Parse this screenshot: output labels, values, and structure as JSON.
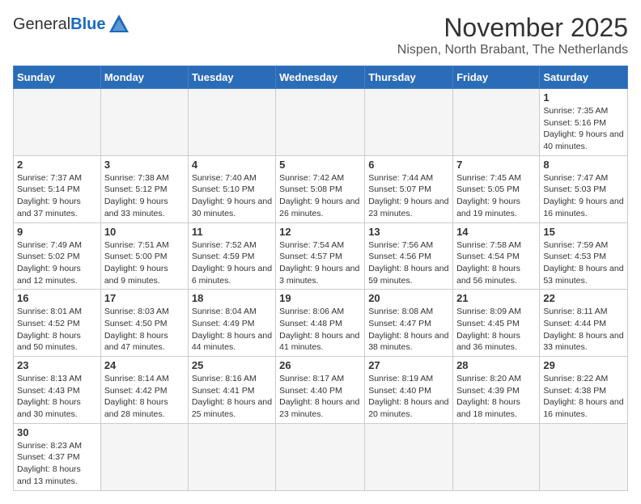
{
  "header": {
    "logo_general": "General",
    "logo_blue": "Blue",
    "month_title": "November 2025",
    "location": "Nispen, North Brabant, The Netherlands"
  },
  "weekdays": [
    "Sunday",
    "Monday",
    "Tuesday",
    "Wednesday",
    "Thursday",
    "Friday",
    "Saturday"
  ],
  "days": [
    {
      "date": "",
      "info": ""
    },
    {
      "date": "",
      "info": ""
    },
    {
      "date": "",
      "info": ""
    },
    {
      "date": "",
      "info": ""
    },
    {
      "date": "",
      "info": ""
    },
    {
      "date": "",
      "info": ""
    },
    {
      "date": "1",
      "info": "Sunrise: 7:35 AM\nSunset: 5:16 PM\nDaylight: 9 hours and 40 minutes."
    },
    {
      "date": "2",
      "info": "Sunrise: 7:37 AM\nSunset: 5:14 PM\nDaylight: 9 hours and 37 minutes."
    },
    {
      "date": "3",
      "info": "Sunrise: 7:38 AM\nSunset: 5:12 PM\nDaylight: 9 hours and 33 minutes."
    },
    {
      "date": "4",
      "info": "Sunrise: 7:40 AM\nSunset: 5:10 PM\nDaylight: 9 hours and 30 minutes."
    },
    {
      "date": "5",
      "info": "Sunrise: 7:42 AM\nSunset: 5:08 PM\nDaylight: 9 hours and 26 minutes."
    },
    {
      "date": "6",
      "info": "Sunrise: 7:44 AM\nSunset: 5:07 PM\nDaylight: 9 hours and 23 minutes."
    },
    {
      "date": "7",
      "info": "Sunrise: 7:45 AM\nSunset: 5:05 PM\nDaylight: 9 hours and 19 minutes."
    },
    {
      "date": "8",
      "info": "Sunrise: 7:47 AM\nSunset: 5:03 PM\nDaylight: 9 hours and 16 minutes."
    },
    {
      "date": "9",
      "info": "Sunrise: 7:49 AM\nSunset: 5:02 PM\nDaylight: 9 hours and 12 minutes."
    },
    {
      "date": "10",
      "info": "Sunrise: 7:51 AM\nSunset: 5:00 PM\nDaylight: 9 hours and 9 minutes."
    },
    {
      "date": "11",
      "info": "Sunrise: 7:52 AM\nSunset: 4:59 PM\nDaylight: 9 hours and 6 minutes."
    },
    {
      "date": "12",
      "info": "Sunrise: 7:54 AM\nSunset: 4:57 PM\nDaylight: 9 hours and 3 minutes."
    },
    {
      "date": "13",
      "info": "Sunrise: 7:56 AM\nSunset: 4:56 PM\nDaylight: 8 hours and 59 minutes."
    },
    {
      "date": "14",
      "info": "Sunrise: 7:58 AM\nSunset: 4:54 PM\nDaylight: 8 hours and 56 minutes."
    },
    {
      "date": "15",
      "info": "Sunrise: 7:59 AM\nSunset: 4:53 PM\nDaylight: 8 hours and 53 minutes."
    },
    {
      "date": "16",
      "info": "Sunrise: 8:01 AM\nSunset: 4:52 PM\nDaylight: 8 hours and 50 minutes."
    },
    {
      "date": "17",
      "info": "Sunrise: 8:03 AM\nSunset: 4:50 PM\nDaylight: 8 hours and 47 minutes."
    },
    {
      "date": "18",
      "info": "Sunrise: 8:04 AM\nSunset: 4:49 PM\nDaylight: 8 hours and 44 minutes."
    },
    {
      "date": "19",
      "info": "Sunrise: 8:06 AM\nSunset: 4:48 PM\nDaylight: 8 hours and 41 minutes."
    },
    {
      "date": "20",
      "info": "Sunrise: 8:08 AM\nSunset: 4:47 PM\nDaylight: 8 hours and 38 minutes."
    },
    {
      "date": "21",
      "info": "Sunrise: 8:09 AM\nSunset: 4:45 PM\nDaylight: 8 hours and 36 minutes."
    },
    {
      "date": "22",
      "info": "Sunrise: 8:11 AM\nSunset: 4:44 PM\nDaylight: 8 hours and 33 minutes."
    },
    {
      "date": "23",
      "info": "Sunrise: 8:13 AM\nSunset: 4:43 PM\nDaylight: 8 hours and 30 minutes."
    },
    {
      "date": "24",
      "info": "Sunrise: 8:14 AM\nSunset: 4:42 PM\nDaylight: 8 hours and 28 minutes."
    },
    {
      "date": "25",
      "info": "Sunrise: 8:16 AM\nSunset: 4:41 PM\nDaylight: 8 hours and 25 minutes."
    },
    {
      "date": "26",
      "info": "Sunrise: 8:17 AM\nSunset: 4:40 PM\nDaylight: 8 hours and 23 minutes."
    },
    {
      "date": "27",
      "info": "Sunrise: 8:19 AM\nSunset: 4:40 PM\nDaylight: 8 hours and 20 minutes."
    },
    {
      "date": "28",
      "info": "Sunrise: 8:20 AM\nSunset: 4:39 PM\nDaylight: 8 hours and 18 minutes."
    },
    {
      "date": "29",
      "info": "Sunrise: 8:22 AM\nSunset: 4:38 PM\nDaylight: 8 hours and 16 minutes."
    },
    {
      "date": "30",
      "info": "Sunrise: 8:23 AM\nSunset: 4:37 PM\nDaylight: 8 hours and 13 minutes."
    },
    {
      "date": "",
      "info": ""
    },
    {
      "date": "",
      "info": ""
    },
    {
      "date": "",
      "info": ""
    },
    {
      "date": "",
      "info": ""
    },
    {
      "date": "",
      "info": ""
    },
    {
      "date": "",
      "info": ""
    }
  ]
}
